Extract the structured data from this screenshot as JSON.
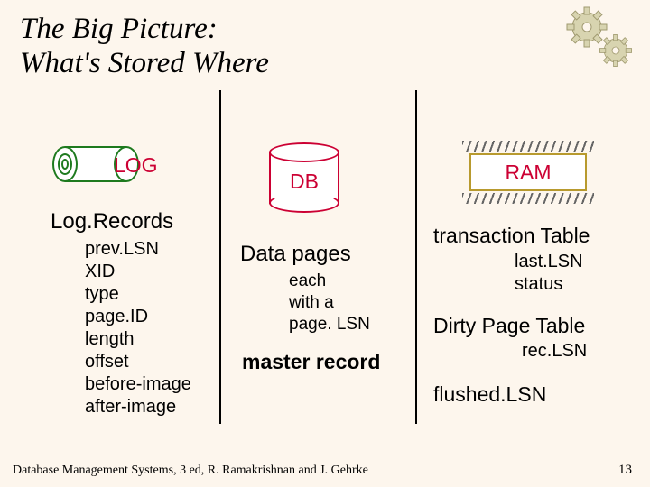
{
  "title_line1": "The Big Picture:",
  "title_line2": "What's Stored Where",
  "log": {
    "label": "LOG",
    "records_heading": "Log.Records",
    "fields": [
      "prev.LSN",
      "XID",
      "type",
      "page.ID",
      "length",
      "offset",
      "before-image",
      "after-image"
    ]
  },
  "db": {
    "label": "DB",
    "data_pages_heading": "Data pages",
    "each_lines": [
      "each",
      "with a",
      "page. LSN"
    ],
    "master_record": "master record"
  },
  "ram": {
    "label": "RAM",
    "tt_heading": "transaction Table",
    "tt_fields": [
      "last.LSN",
      "status"
    ],
    "dpt_heading": "Dirty Page Table",
    "dpt_field": "rec.LSN",
    "flushed": "flushed.LSN"
  },
  "footer": "Database Management Systems, 3 ed, R. Ramakrishnan and J. Gehrke",
  "page_number": "13"
}
